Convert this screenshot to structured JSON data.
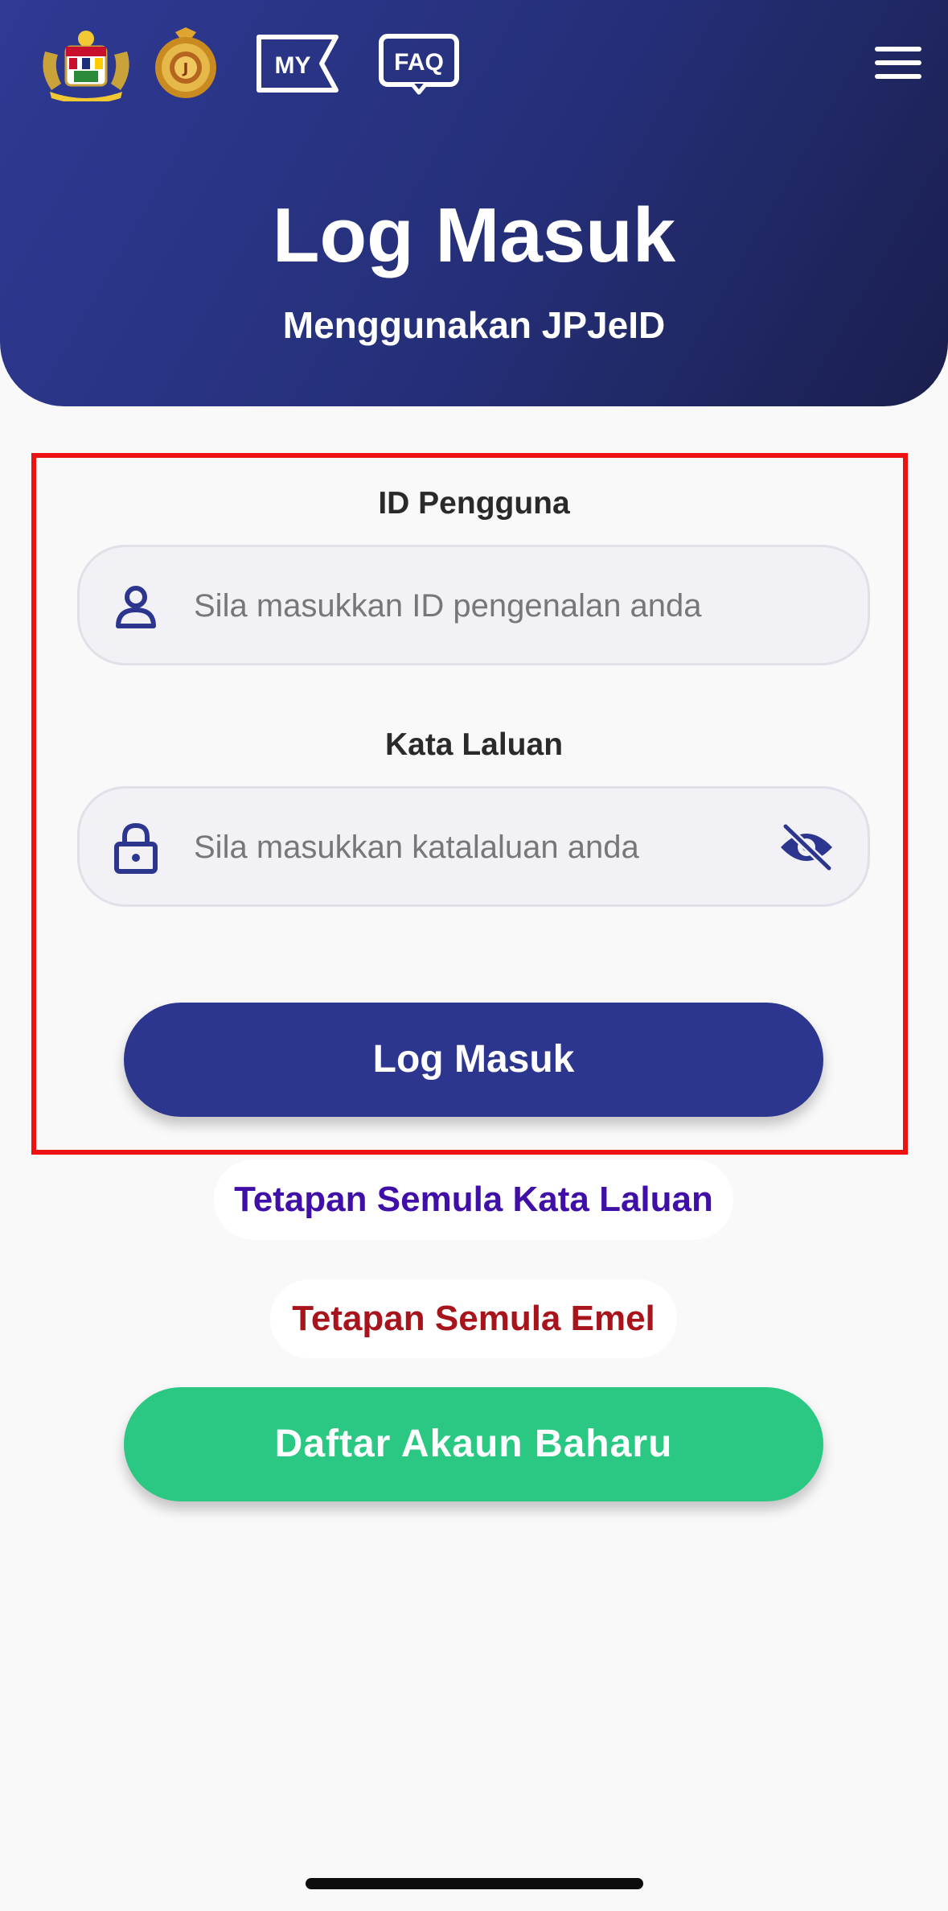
{
  "header": {
    "icons": [
      "coat-of-arms-emblem",
      "jpj-emblem",
      "my-icon",
      "faq-icon",
      "hamburger-menu-icon"
    ],
    "my_label": "MY",
    "faq_label": "FAQ",
    "title": "Log Masuk",
    "subtitle": "Menggunakan JPJeID"
  },
  "form": {
    "user_id": {
      "label": "ID Pengguna",
      "placeholder": "Sila masukkan ID pengenalan anda",
      "value": "",
      "icon": "user-icon"
    },
    "password": {
      "label": "Kata Laluan",
      "placeholder": "Sila masukkan katalaluan anda",
      "value": "",
      "icon": "lock-icon",
      "toggle_icon": "eye-slash-icon"
    },
    "login_button": "Log Masuk"
  },
  "links": {
    "reset_password": "Tetapan Semula Kata Laluan",
    "reset_email": "Tetapan Semula Emel"
  },
  "register_button": "Daftar Akaun Baharu",
  "colors": {
    "header_start": "#2e3a94",
    "header_end": "#1a1f4e",
    "primary_button": "#2c368e",
    "register_button": "#2bc884",
    "reset_password_link": "#3f0fa8",
    "reset_email_link": "#a8141c",
    "highlight_border": "#ee1111"
  }
}
